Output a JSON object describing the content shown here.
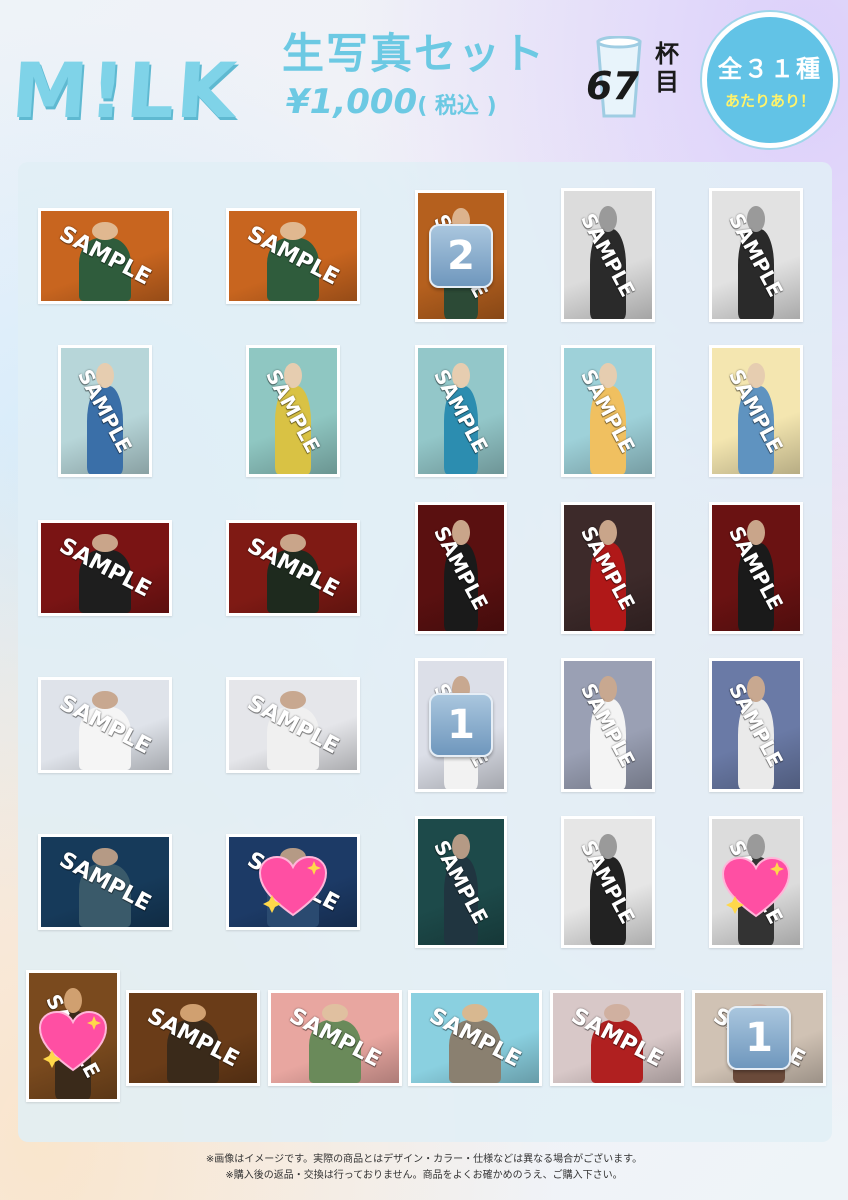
{
  "header": {
    "logo": "M!LK",
    "title": "生写真セット",
    "price": "¥1,000",
    "tax": "( 税込 )",
    "cup_number": "67",
    "cup_label": "杯目",
    "badge_main": "全３１種",
    "badge_sub": "あたりあり！"
  },
  "sample_text": "SAMPLE",
  "photos": [
    {
      "bg": "#c8651f",
      "fig": "#2f5c3c",
      "head": "#e0b890",
      "badge": null
    },
    {
      "bg": "#c8651f",
      "fig": "#2f5c3c",
      "head": "#e0b890",
      "badge": null
    },
    {
      "bg": "#b5601e",
      "fig": "#2c4a36",
      "head": "#dcb38d",
      "badge": "2"
    },
    {
      "bg": "#dcdcdc",
      "fig": "#2a2a2a",
      "head": "#9a9a9a",
      "badge": null
    },
    {
      "bg": "#e2e2e2",
      "fig": "#2a2a2a",
      "head": "#9a9a9a",
      "badge": null
    },
    {
      "bg": "#b7d6d9",
      "fig": "#3a6fa8",
      "head": "#e6cdb0",
      "badge": null
    },
    {
      "bg": "#8fc7c2",
      "fig": "#d9c244",
      "head": "#e6cdb0",
      "badge": null
    },
    {
      "bg": "#93c7c9",
      "fig": "#2c8db0",
      "head": "#e6cdb0",
      "badge": null
    },
    {
      "bg": "#9ed1d9",
      "fig": "#f0c060",
      "head": "#e6cdb0",
      "badge": null
    },
    {
      "bg": "#f4e6b0",
      "fig": "#5f93c0",
      "head": "#e6cdb0",
      "badge": null
    },
    {
      "bg": "#7a1414",
      "fig": "#1e1e1e",
      "head": "#c9a58a",
      "badge": null
    },
    {
      "bg": "#7f1a14",
      "fig": "#1e2a1e",
      "head": "#c9a58a",
      "badge": null
    },
    {
      "bg": "#5a1010",
      "fig": "#1a1a1a",
      "head": "#c9a58a",
      "badge": null
    },
    {
      "bg": "#3d2a2a",
      "fig": "#b01818",
      "head": "#c9a58a",
      "badge": null
    },
    {
      "bg": "#6a1212",
      "fig": "#1a1a1a",
      "head": "#c9a58a",
      "badge": null
    },
    {
      "bg": "#dfe3ea",
      "fig": "#f5f5f5",
      "head": "#c8a890",
      "badge": null
    },
    {
      "bg": "#e5e6ea",
      "fig": "#f0f0f0",
      "head": "#c8a890",
      "badge": null
    },
    {
      "bg": "#dcdfe8",
      "fig": "#f2f2f2",
      "head": "#c8a890",
      "badge": "1"
    },
    {
      "bg": "#9aa0b4",
      "fig": "#f4f4f4",
      "head": "#c8a890",
      "badge": null
    },
    {
      "bg": "#6a7aa6",
      "fig": "#eaeaea",
      "head": "#c8a890",
      "badge": null
    },
    {
      "bg": "#163a5a",
      "fig": "#3a5a6a",
      "head": "#b59a85",
      "badge": null
    },
    {
      "bg": "#1c3a66",
      "fig": "#2a4a70",
      "head": "#b59a85",
      "badge": "heart"
    },
    {
      "bg": "#1d4a4a",
      "fig": "#203540",
      "head": "#b59a85",
      "badge": null
    },
    {
      "bg": "#e6e6e6",
      "fig": "#222222",
      "head": "#9a9a9a",
      "badge": null
    },
    {
      "bg": "#dcdcdc",
      "fig": "#333333",
      "head": "#9a9a9a",
      "badge": "heart"
    },
    {
      "bg": "#7a4a1e",
      "fig": "#3a2a1a",
      "head": "#d0a070",
      "badge": "heart"
    },
    {
      "bg": "#6a3c18",
      "fig": "#3a2a1a",
      "head": "#d0a070",
      "badge": null
    },
    {
      "bg": "#e8a6a0",
      "fig": "#6a8a5a",
      "head": "#e0c0a0",
      "badge": null
    },
    {
      "bg": "#8ad0e0",
      "fig": "#8a8070",
      "head": "#d8b890",
      "badge": null
    },
    {
      "bg": "#d8c8c8",
      "fig": "#b02020",
      "head": "#d0b0a0",
      "badge": null
    },
    {
      "bg": "#d0c2b4",
      "fig": "#6a4a3a",
      "head": "#d0b0a0",
      "badge": "1"
    }
  ],
  "footer": {
    "line1": "※画像はイメージです。実際の商品とはデザイン・カラー・仕様などは異なる場合がございます。",
    "line2": "※購入後の返品・交換は行っておりません。商品をよくお確かめのうえ、ご購入下さい。"
  }
}
